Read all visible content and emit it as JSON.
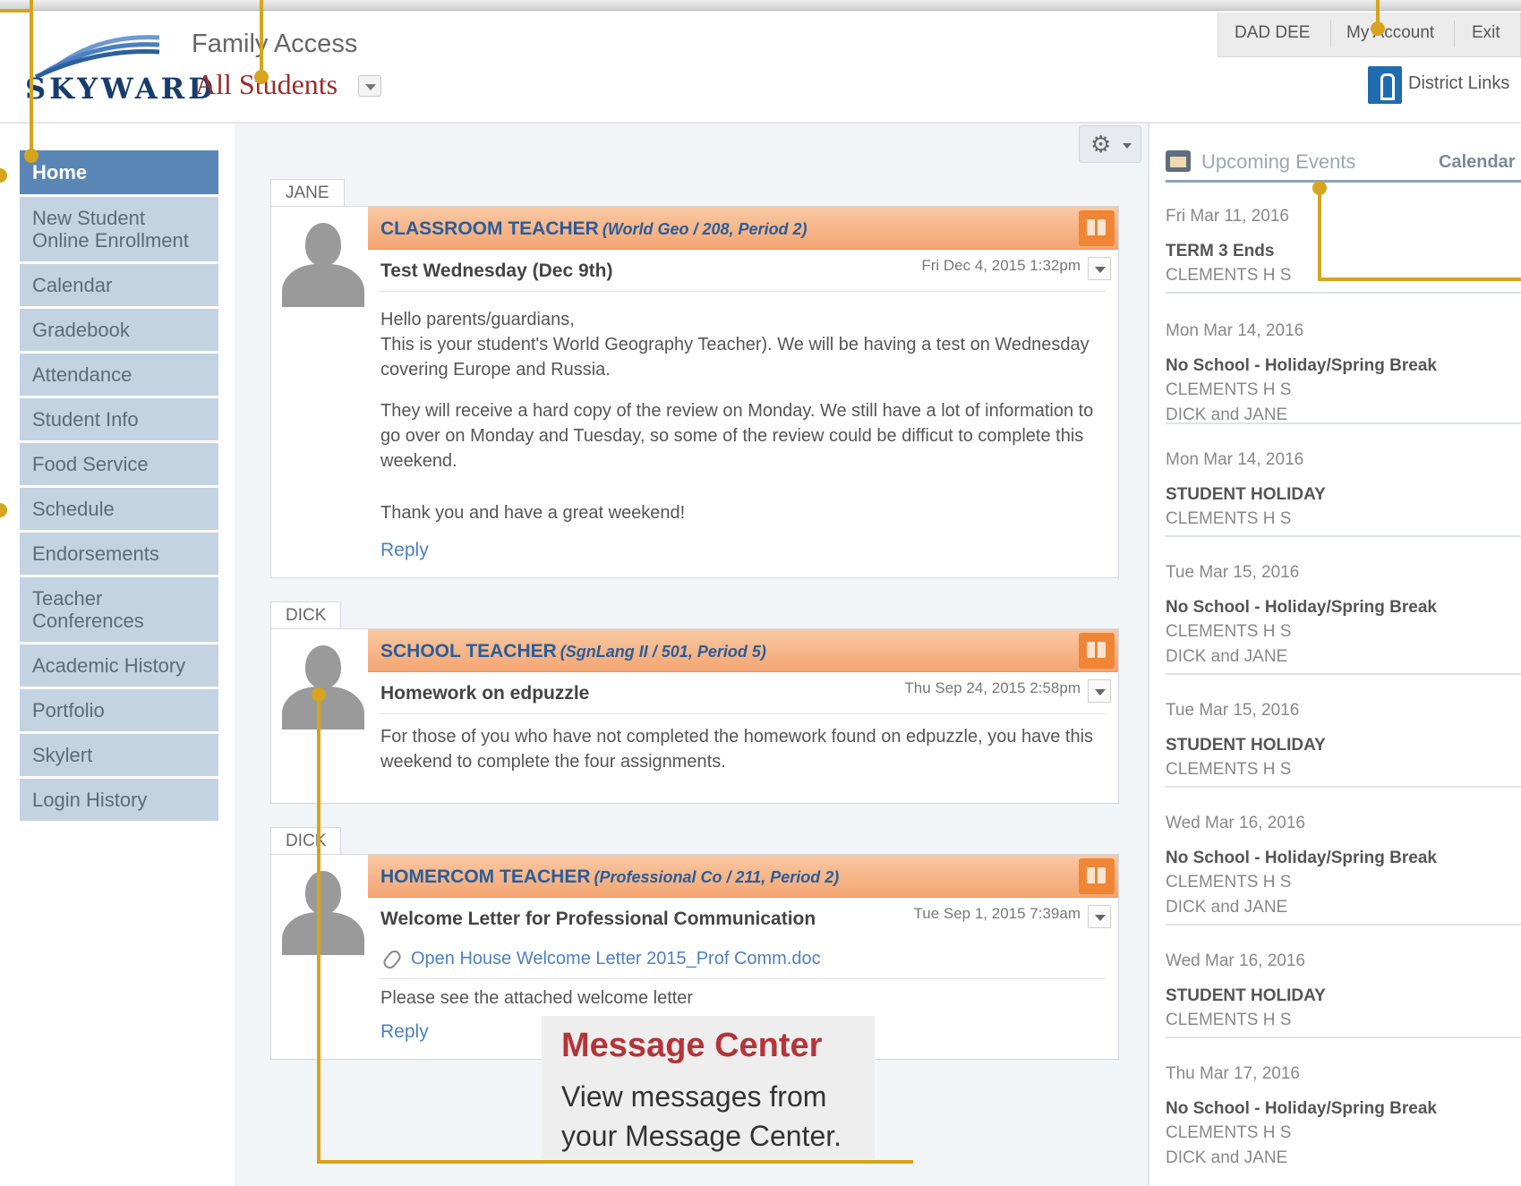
{
  "header": {
    "logo_text": "SKYWARD",
    "app_title": "Family Access",
    "student_selector": "All Students",
    "user_name": "DAD DEE",
    "my_account": "My Account",
    "exit": "Exit",
    "district_links": "District Links"
  },
  "sidebar": {
    "items": [
      {
        "label": "Home",
        "active": true
      },
      {
        "label": "New Student Online Enrollment"
      },
      {
        "label": "Calendar"
      },
      {
        "label": "Gradebook"
      },
      {
        "label": "Attendance"
      },
      {
        "label": "Student Info"
      },
      {
        "label": "Food Service"
      },
      {
        "label": "Schedule"
      },
      {
        "label": "Endorsements"
      },
      {
        "label": "Teacher Conferences"
      },
      {
        "label": "Academic History"
      },
      {
        "label": "Portfolio"
      },
      {
        "label": "Skylert"
      },
      {
        "label": "Login History"
      }
    ]
  },
  "messages": [
    {
      "student": "JANE",
      "sender": "CLASSROOM TEACHER",
      "course": "(World Geo / 208, Period 2)",
      "subject": "Test Wednesday (Dec 9th)",
      "date": "Fri Dec 4, 2015 1:32pm",
      "body": [
        "Hello parents/guardians,",
        "This is your student's World Geography Teacher). We will be having a test on Wednesday covering Europe and Russia.",
        "They will receive a hard copy of the review on Monday. We still have a lot of information to go over on Monday and Tuesday, so some of the review could be difficut to complete this weekend.",
        "Thank you and have a great weekend!"
      ],
      "reply": "Reply"
    },
    {
      "student": "DICK",
      "sender": "SCHOOL TEACHER",
      "course": "(SgnLang II / 501, Period 5)",
      "subject": "Homework on edpuzzle",
      "date": "Thu Sep 24, 2015 2:58pm",
      "body": [
        "For those of you who have not completed the homework found on edpuzzle, you have this weekend to complete the four assignments."
      ]
    },
    {
      "student": "DICK",
      "sender": "HOMERCOM TEACHER",
      "course": "(Professional Co / 211, Period 2)",
      "subject": "Welcome Letter for Professional Communication",
      "date": "Tue Sep 1, 2015 7:39am",
      "attachment": "Open House Welcome Letter 2015_Prof Comm.doc",
      "body": [
        "Please see the attached welcome letter"
      ],
      "reply": "Reply"
    }
  ],
  "events_panel": {
    "title": "Upcoming Events",
    "calendar_link": "Calendar",
    "events": [
      {
        "date": "Fri Mar 11, 2016",
        "title": "TERM 3 Ends",
        "lines": [
          "CLEMENTS H S"
        ]
      },
      {
        "date": "Mon Mar 14, 2016",
        "title": "No School - Holiday/Spring Break",
        "lines": [
          "CLEMENTS H S",
          "DICK and JANE"
        ]
      },
      {
        "date": "Mon Mar 14, 2016",
        "title": "STUDENT HOLIDAY",
        "lines": [
          "CLEMENTS H S"
        ]
      },
      {
        "date": "Tue Mar 15, 2016",
        "title": "No School - Holiday/Spring Break",
        "lines": [
          "CLEMENTS H S",
          "DICK and JANE"
        ]
      },
      {
        "date": "Tue Mar 15, 2016",
        "title": "STUDENT HOLIDAY",
        "lines": [
          "CLEMENTS H S"
        ]
      },
      {
        "date": "Wed Mar 16, 2016",
        "title": "No School - Holiday/Spring Break",
        "lines": [
          "CLEMENTS H S",
          "DICK and JANE"
        ]
      },
      {
        "date": "Wed Mar 16, 2016",
        "title": "STUDENT HOLIDAY",
        "lines": [
          "CLEMENTS H S"
        ]
      },
      {
        "date": "Thu Mar 17, 2016",
        "title": "No School - Holiday/Spring Break",
        "lines": [
          "CLEMENTS H S",
          "DICK and JANE"
        ]
      }
    ]
  },
  "callout": {
    "title": "Message Center",
    "text": "View messages from your Message Center."
  },
  "colors": {
    "nav_active": "#5a86b6",
    "nav_item": "#c3d3e2",
    "message_header": "#f4a572",
    "sender_text": "#2a5d9a",
    "callout_line": "#d6a41e",
    "callout_title": "#b4343a"
  },
  "icons": [
    "gear-icon",
    "book-icon",
    "calendar-icon",
    "district-links-icon",
    "paperclip-icon",
    "chevron-down-icon",
    "avatar-placeholder-icon"
  ]
}
